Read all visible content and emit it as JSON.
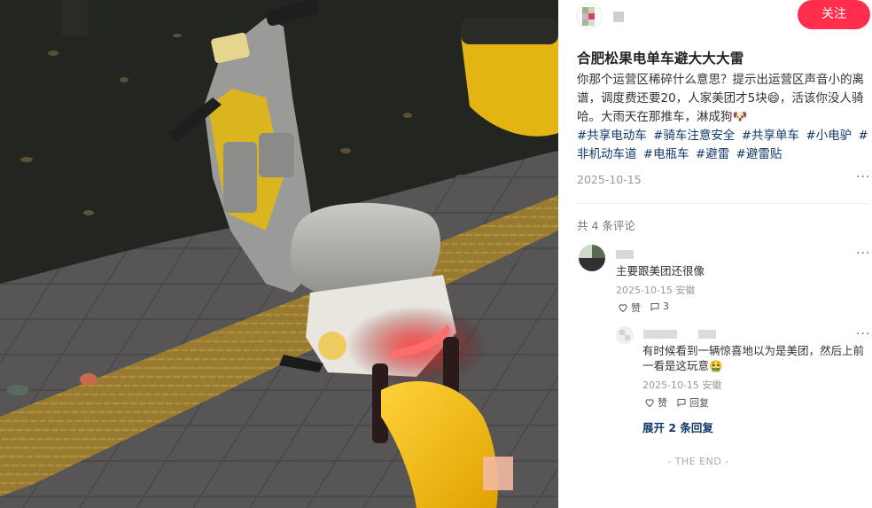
{
  "post": {
    "follow_label": "关注",
    "title": "合肥松果电单车避大大大雷",
    "body": "你那个运营区稀碎什么意思？提示出运营区声音小的离谱，调度费还要20，人家美团才5块😄，活该你没人骑哈。大雨天在那推车，淋成狗🐶",
    "tags": [
      "#共享电动车",
      "#骑车注意安全",
      "#共享单车",
      "#小电驴",
      "#非机动车道",
      "#电瓶车",
      "#避雷",
      "#避雷贴"
    ],
    "date": "2025-10-15",
    "more_icon": "more-dots-icon"
  },
  "comments": {
    "count_label": "共 4 条评论",
    "items": [
      {
        "text": "主要跟美团还很像",
        "meta": "2025-10-15 安徽",
        "like_label": "赞",
        "reply_label": "3"
      }
    ],
    "reply": {
      "text": "有时候看到一辆惊喜地以为是美团，然后上前一看是这玩意🤮",
      "meta": "2025-10-15 安徽",
      "like_label": "赞",
      "reply_label": "回复"
    },
    "expand_label": "展开 2 条回复"
  },
  "footer": {
    "end_label": "- THE END -"
  },
  "colors": {
    "accent": "#ff2e4d",
    "tag": "#13386c"
  }
}
